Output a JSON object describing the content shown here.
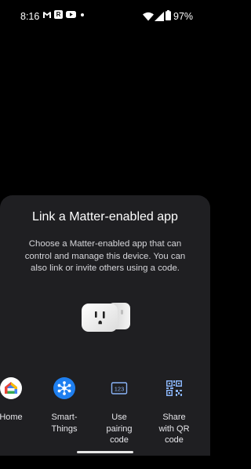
{
  "status_bar": {
    "time": "8:16",
    "ring_glyph": "R",
    "battery": "97%",
    "icons": [
      "gmail-icon",
      "ring-icon",
      "youtube-icon",
      "dot-icon",
      "wifi-icon",
      "signal-icon",
      "battery-icon"
    ]
  },
  "sheet": {
    "title": "Link a Matter-enabled app",
    "description": "Choose a Matter-enabled app that can control and manage this device. You can also link or invite others using a code.",
    "device_image": "smart-plug"
  },
  "apps": [
    {
      "label": "Home",
      "icon": "google-home-icon"
    },
    {
      "label": "Smart-Things",
      "line1": "Smart-",
      "line2": "Things",
      "icon": "smartthings-icon"
    },
    {
      "label": "Use pairing code",
      "line1": "Use",
      "line2": "pairing",
      "line3": "code",
      "icon": "pairing-code-icon",
      "code_glyph": "123"
    },
    {
      "label": "Share with QR code",
      "line1": "Share",
      "line2": "with QR",
      "line3": "code",
      "icon": "qr-code-icon"
    }
  ],
  "colors": {
    "background": "#000000",
    "sheet": "#1f1f22",
    "accent_blue": "#1a73e8",
    "smartthings_blue": "#1e7ff0"
  }
}
